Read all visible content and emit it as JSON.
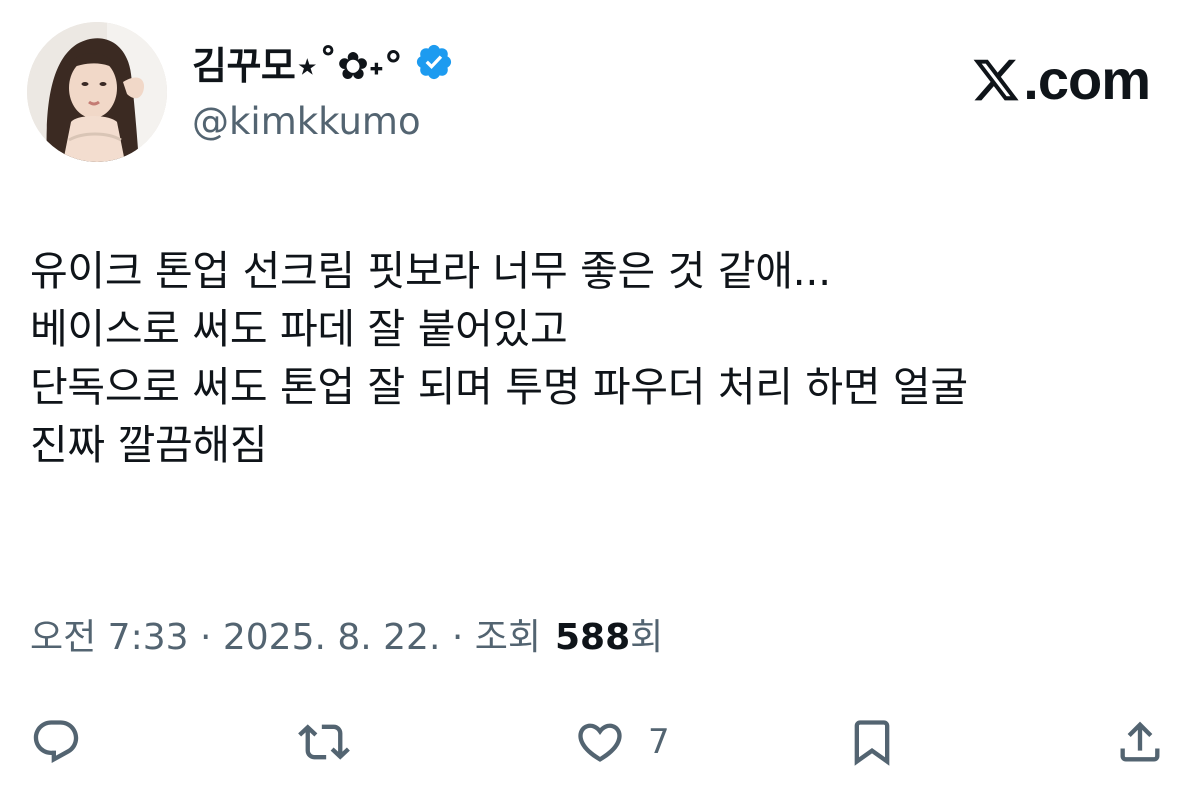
{
  "author": {
    "display_name": "김꾸모⋆˚✿˖°",
    "handle": "@kimkkumo",
    "verified": true
  },
  "brand": {
    "logo_icon": "x-logo-icon",
    "text": ".com"
  },
  "tweet": {
    "lines": [
      "유이크 톤업 선크림 핏보라 너무 좋은 것 같애...",
      "베이스로 써도 파데 잘 붙어있고",
      "단독으로 써도 톤업 잘 되며 투명 파우더 처리 하면 얼굴",
      "진짜 깔끔해짐"
    ]
  },
  "meta": {
    "time_date": "오전 7:33 · 2025. 8. 22. · 조회",
    "views_count": "588",
    "views_suffix": "회"
  },
  "actions": {
    "reply": {
      "icon": "reply-icon"
    },
    "retweet": {
      "icon": "retweet-icon"
    },
    "like": {
      "icon": "heart-icon",
      "count": "7"
    },
    "bookmark": {
      "icon": "bookmark-icon"
    },
    "share": {
      "icon": "share-icon"
    }
  },
  "colors": {
    "text_primary": "#0f1419",
    "text_secondary": "#536471",
    "verified_blue": "#1d9bf0"
  }
}
